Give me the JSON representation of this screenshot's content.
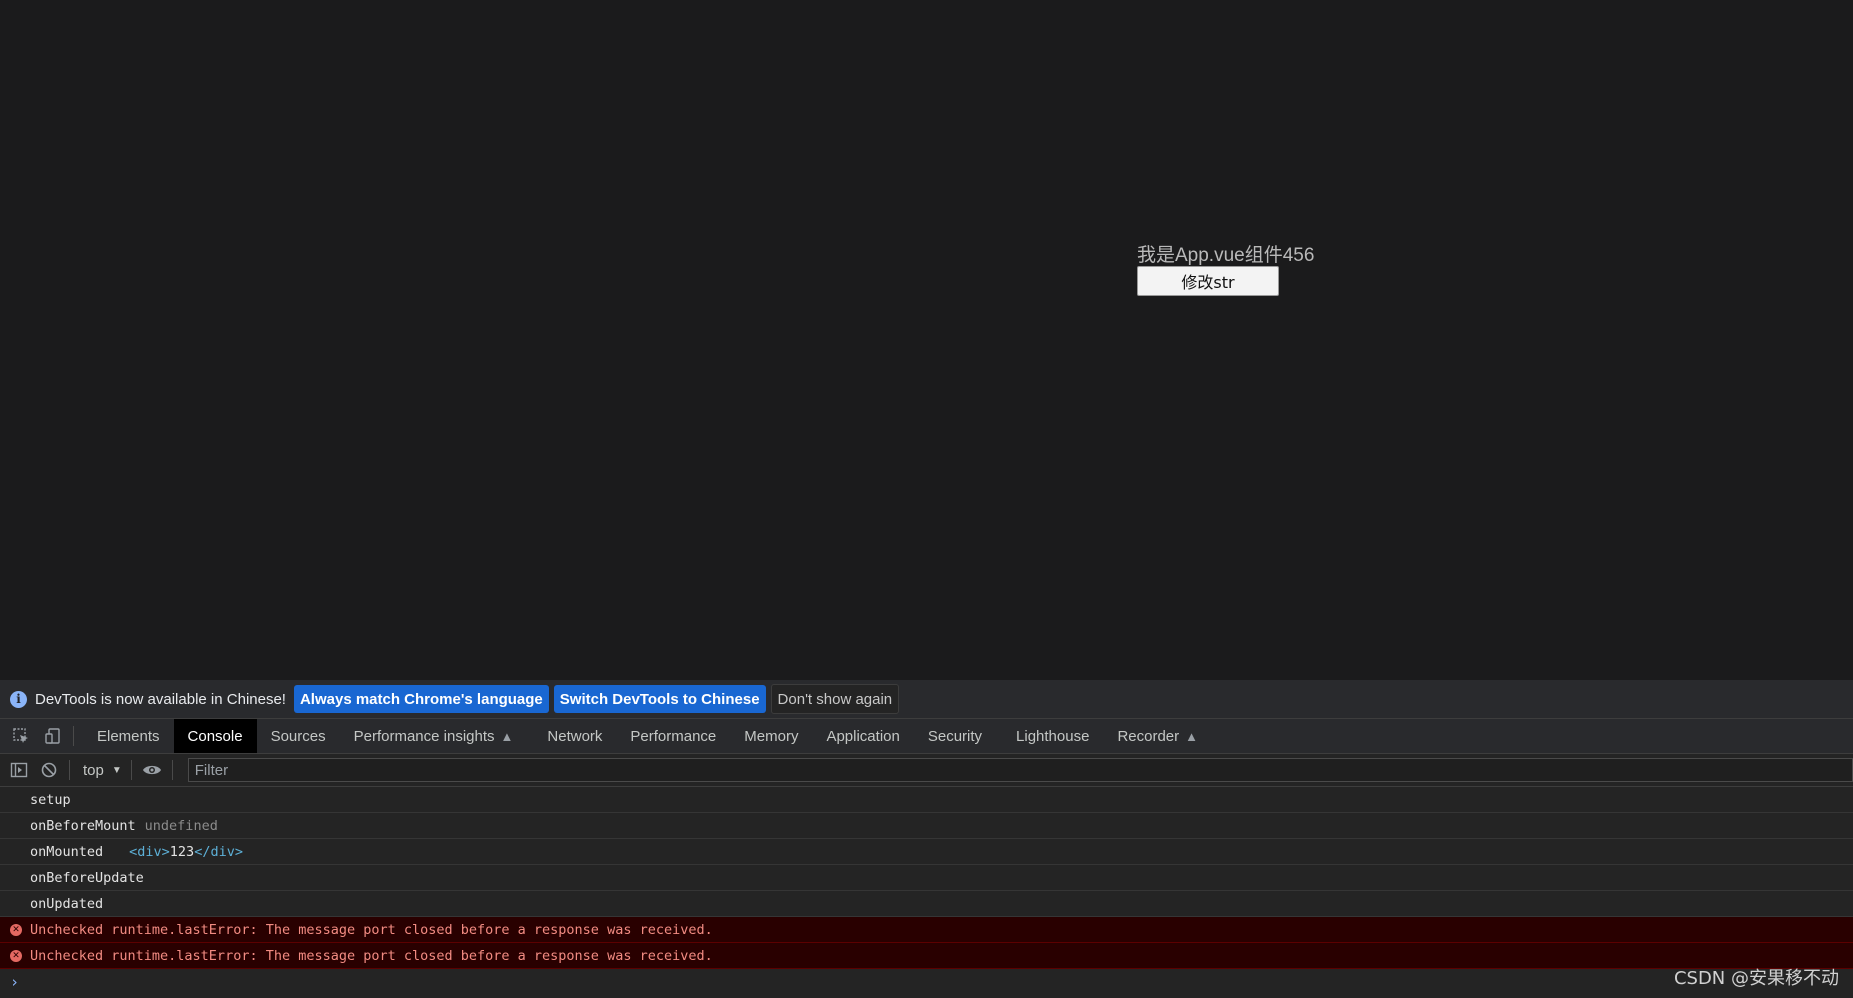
{
  "app": {
    "title": "我是App.vue组件456",
    "button_label": "修改str"
  },
  "infobar": {
    "message": "DevTools is now available in Chinese!",
    "btn_match": "Always match Chrome's language",
    "btn_switch": "Switch DevTools to Chinese",
    "btn_dismiss": "Don't show again"
  },
  "tabs": [
    {
      "label": "Elements"
    },
    {
      "label": "Console",
      "active": true
    },
    {
      "label": "Sources"
    },
    {
      "label": "Performance insights",
      "flask": true
    },
    {
      "label": "Network"
    },
    {
      "label": "Performance"
    },
    {
      "label": "Memory"
    },
    {
      "label": "Application"
    },
    {
      "label": "Security"
    },
    {
      "label": "Lighthouse"
    },
    {
      "label": "Recorder",
      "flask": true
    }
  ],
  "console_toolbar": {
    "context": "top",
    "filter_placeholder": "Filter"
  },
  "logs": {
    "setup": "setup",
    "before_mount": "onBeforeMount",
    "before_mount_value": "undefined",
    "mounted": "onMounted",
    "mounted_open_tag": "<div>",
    "mounted_text": "123",
    "mounted_close_tag": "</div>",
    "before_update": "onBeforeUpdate",
    "updated": "onUpdated",
    "error1": "Unchecked runtime.lastError: The message port closed before a response was received.",
    "error2": "Unchecked runtime.lastError: The message port closed before a response was received."
  },
  "prompt_symbol": "›",
  "watermark": "CSDN @安果移不动",
  "colors": {
    "page_bg": "#1b1b1c",
    "primary_button": "#1967d2",
    "error_bg": "#290000",
    "error_text": "#f28b82"
  }
}
